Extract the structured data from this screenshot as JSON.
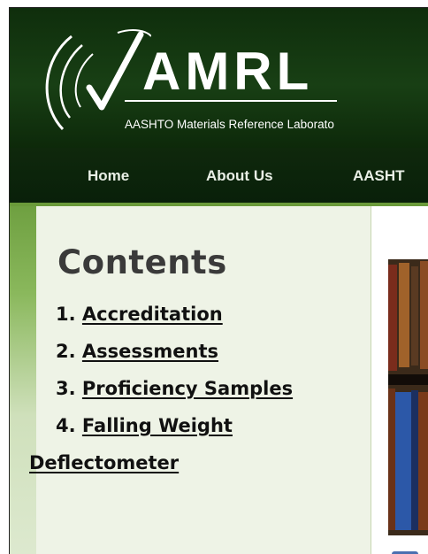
{
  "header": {
    "logo_name": "AMRL",
    "logo_subtitle": "AASHTO Materials Reference Laborato"
  },
  "nav": {
    "items": [
      {
        "label": "Home"
      },
      {
        "label": "About Us"
      },
      {
        "label": "AASHT"
      }
    ]
  },
  "sidebar": {
    "title": "Contents",
    "items": [
      {
        "number": "1.",
        "label": "Accreditation"
      },
      {
        "number": "2.",
        "label": "Assessments"
      },
      {
        "number": "3.",
        "label": "Proficiency Samples"
      },
      {
        "number": "4.",
        "label": "Falling Weight",
        "continuation": "Deflectometer"
      }
    ]
  },
  "colors": {
    "header_bg": "#183f14",
    "nav_bg": "#0f280c",
    "nav_accent": "#6a9a3a",
    "sidebar_bg": "#eef3e6"
  }
}
